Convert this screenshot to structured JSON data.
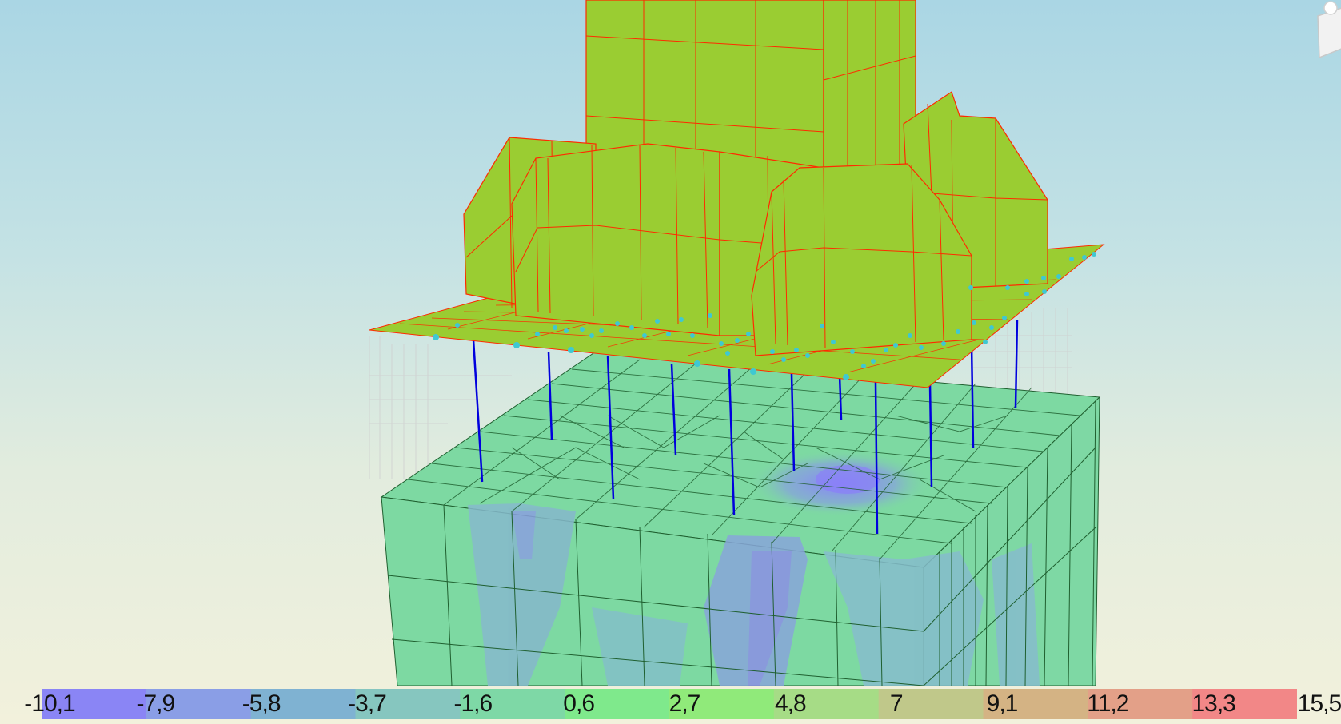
{
  "viewport": {
    "description_name": "3D structural model viewport",
    "background_top": "#aad6e4",
    "background_bottom": "#f2f1dc"
  },
  "colors": {
    "structure_fill": "#9acd32",
    "structure_edge": "#ff2a00",
    "soil_fill": "#7dd9a2",
    "soil_edge": "#1f5f2f",
    "pile_color": "#0000dd",
    "node_color": "#3fc8d2"
  },
  "legend": {
    "labels": [
      "-10,1",
      "-7,9",
      "-5,8",
      "-3,7",
      "-1,6",
      "0,6",
      "2,7",
      "4,8",
      "7",
      "9,1",
      "11,2",
      "13,3",
      "15,5"
    ],
    "colors": [
      "#8a85f5",
      "#8a9ee6",
      "#7fb2d2",
      "#86c6bf",
      "#7ed8a6",
      "#7fe98c",
      "#90ea7a",
      "#a6dc86",
      "#c0c88a",
      "#d4b384",
      "#e3a088",
      "#f28787",
      "#fa8080"
    ]
  },
  "view_cube": {
    "icon": "view-cube-icon"
  }
}
